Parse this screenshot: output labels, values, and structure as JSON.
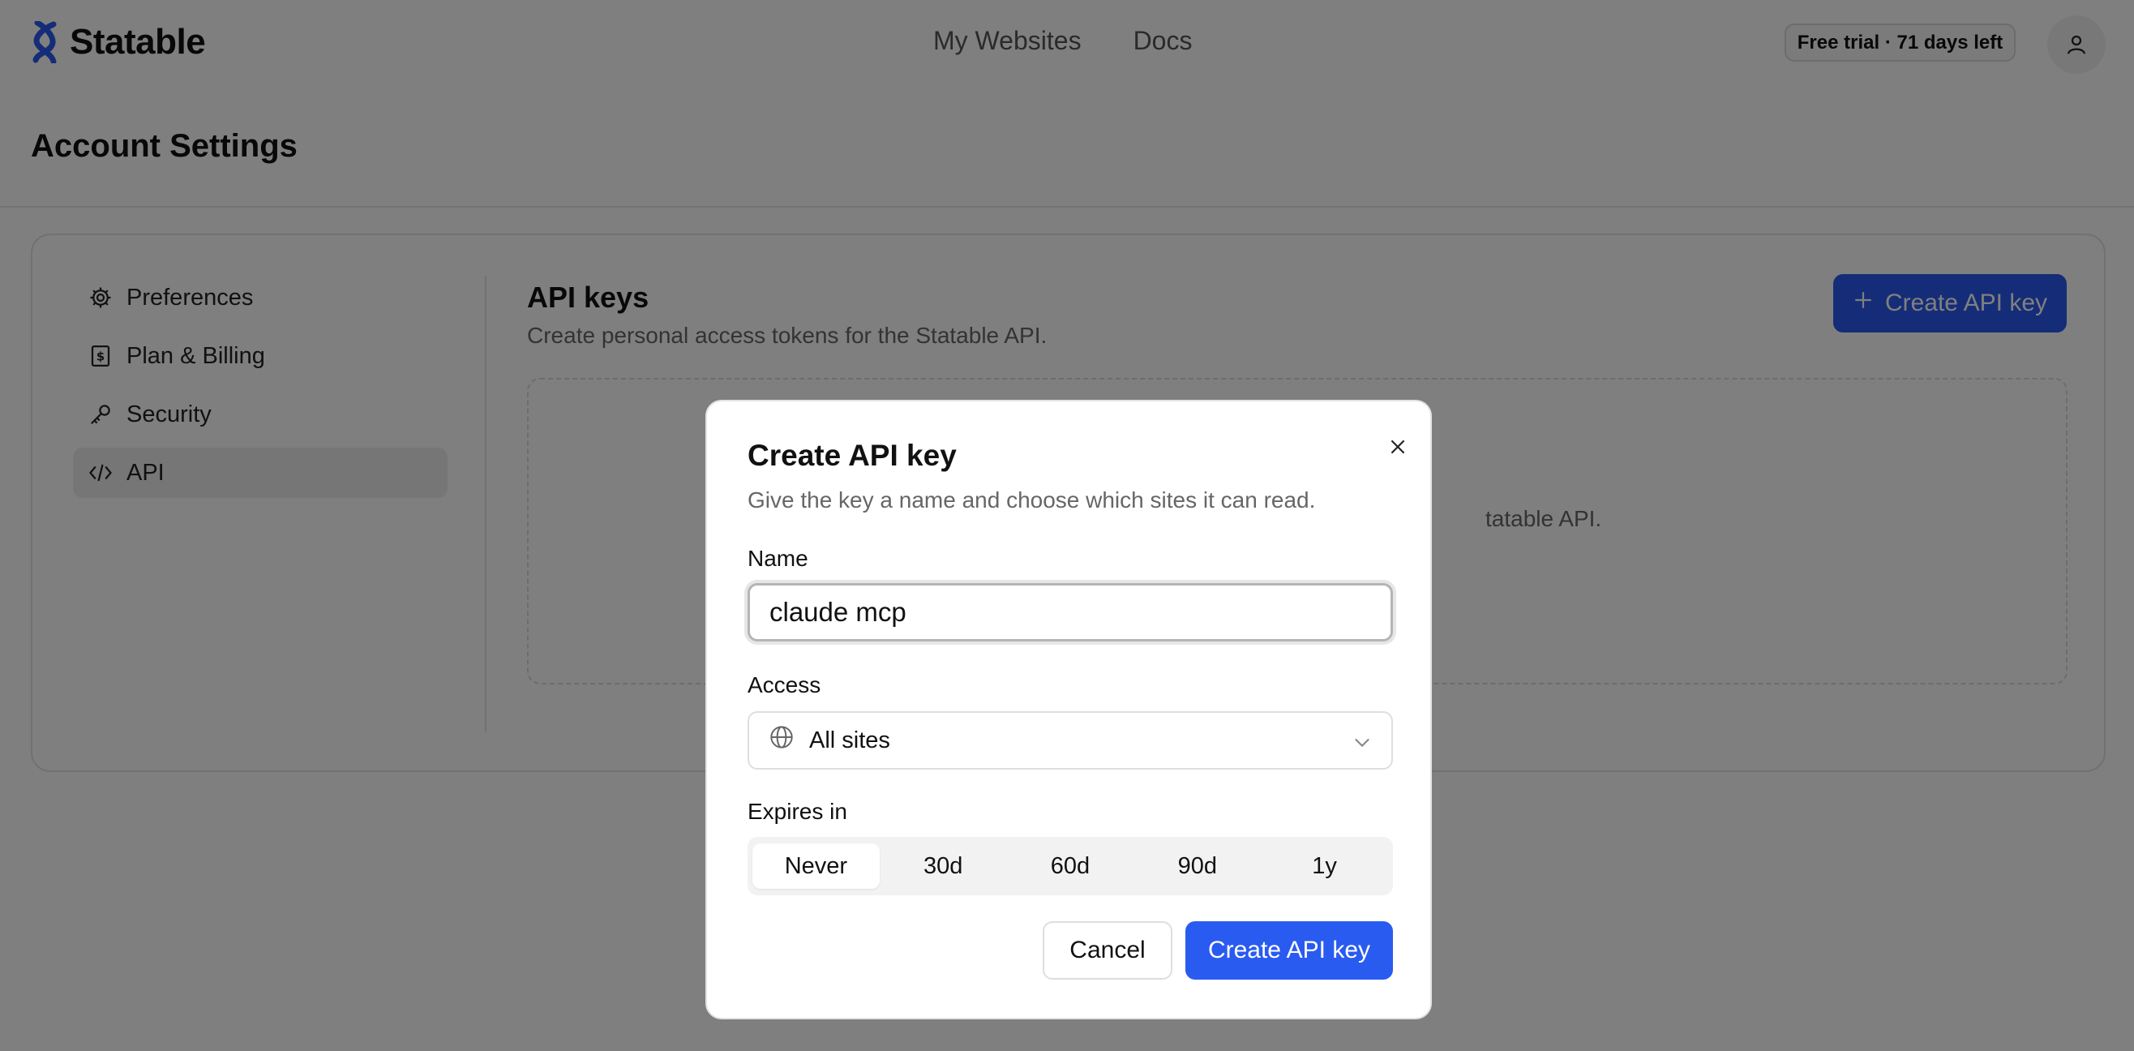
{
  "app": {
    "brand": "Statable",
    "nav": [
      "My Websites",
      "Docs"
    ],
    "trial_badge": "Free trial · 71 days left"
  },
  "page": {
    "title": "Account Settings"
  },
  "sidebar": {
    "items": [
      {
        "label": "Preferences",
        "icon": "gear-icon",
        "active": false
      },
      {
        "label": "Plan & Billing",
        "icon": "billing-icon",
        "active": false
      },
      {
        "label": "Security",
        "icon": "key-icon",
        "active": false
      },
      {
        "label": "API",
        "icon": "code-icon",
        "active": true
      }
    ]
  },
  "api": {
    "title": "API keys",
    "subtitle": "Create personal access tokens for the Statable API.",
    "create_button": "Create API key",
    "empty_text_partial": "tatable API."
  },
  "modal": {
    "title": "Create API key",
    "description": "Give the key a name and choose which sites it can read.",
    "name_label": "Name",
    "name_value": "claude mcp",
    "access_label": "Access",
    "access_value": "All sites",
    "expires_label": "Expires in",
    "expires_options": [
      "Never",
      "30d",
      "60d",
      "90d",
      "1y"
    ],
    "expires_selected": "Never",
    "cancel_label": "Cancel",
    "create_label": "Create API key"
  },
  "colors": {
    "primary": "#2a5bf0",
    "overlay": "rgba(0,0,0,0.5)"
  }
}
